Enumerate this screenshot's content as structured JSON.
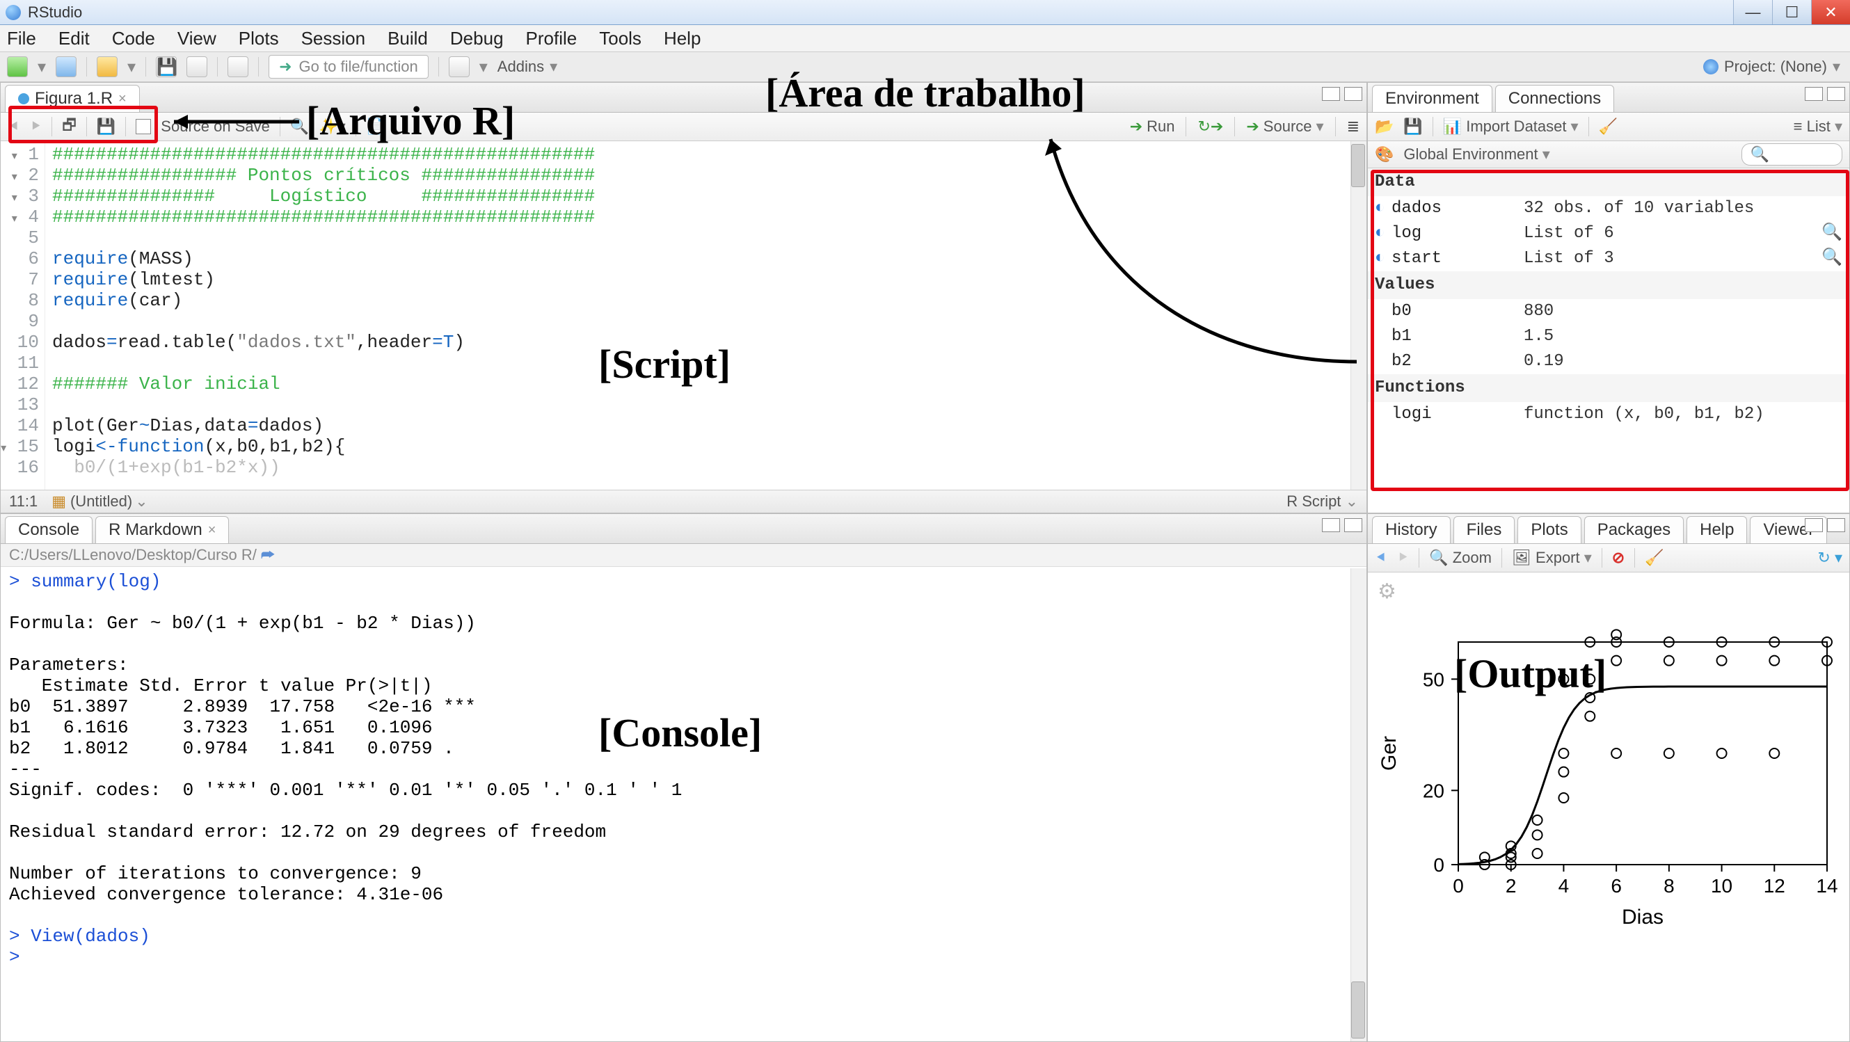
{
  "window_title": "RStudio",
  "menubar": [
    "File",
    "Edit",
    "Code",
    "View",
    "Plots",
    "Session",
    "Build",
    "Debug",
    "Profile",
    "Tools",
    "Help"
  ],
  "toolbar": {
    "goto_placeholder": "Go to file/function",
    "addins": "Addins",
    "project_label": "Project: (None)"
  },
  "source": {
    "tab_name": "Figura 1.R",
    "source_on_save": "Source on Save",
    "run": "Run",
    "source_btn": "Source",
    "status_pos": "11:1",
    "status_doc": "(Untitled)",
    "status_type": "R Script",
    "lines": [
      {
        "n": "1",
        "fold": "▾",
        "html": "<span class='c-com'>##################################################</span>"
      },
      {
        "n": "2",
        "fold": "▾",
        "html": "<span class='c-com'>################# Pontos críticos ################</span>"
      },
      {
        "n": "3",
        "fold": "▾",
        "html": "<span class='c-com'>###############     Logístico     ################</span>"
      },
      {
        "n": "4",
        "fold": "▾",
        "html": "<span class='c-com'>##################################################</span>"
      },
      {
        "n": "5",
        "html": ""
      },
      {
        "n": "6",
        "html": "<span class='c-kw'>require</span>(MASS)"
      },
      {
        "n": "7",
        "html": "<span class='c-kw'>require</span>(lmtest)"
      },
      {
        "n": "8",
        "html": "<span class='c-kw'>require</span>(car)"
      },
      {
        "n": "9",
        "html": ""
      },
      {
        "n": "10",
        "html": "dados<span class='c-op'>=</span>read.table(<span class='c-str'>\"dados.txt\"</span>,header<span class='c-op'>=</span><span class='c-kw'>T</span>)"
      },
      {
        "n": "11",
        "html": ""
      },
      {
        "n": "12",
        "html": "<span class='c-com'>####### Valor inicial</span>"
      },
      {
        "n": "13",
        "html": ""
      },
      {
        "n": "14",
        "html": "plot(Ger<span class='c-op'>~</span>Dias,data<span class='c-op'>=</span>dados)"
      },
      {
        "n": "15",
        "fold": "▾",
        "html": "logi<span class='c-op'>&lt;-</span><span class='c-kw'>function</span>(x,b0,b1,b2){"
      },
      {
        "n": "16",
        "html": "  <span style='color:#bbb'>b0/(1+exp(b1-b2*x))</span>"
      }
    ]
  },
  "console": {
    "tab1": "Console",
    "tab2": "R Markdown",
    "path": "C:/Users/LLenovo/Desktop/Curso R/",
    "text": "> summary(log)\n\nFormula: Ger ~ b0/(1 + exp(b1 - b2 * Dias))\n\nParameters:\n   Estimate Std. Error t value Pr(>|t|)\nb0  51.3897     2.8939  17.758   <2e-16 ***\nb1   6.1616     3.7323   1.651   0.1096\nb2   1.8012     0.9784   1.841   0.0759 .\n---\nSignif. codes:  0 '***' 0.001 '**' 0.01 '*' 0.05 '.' 0.1 ' ' 1\n\nResidual standard error: 12.72 on 29 degrees of freedom\n\nNumber of iterations to convergence: 9\nAchieved convergence tolerance: 4.31e-06\n\n> View(dados)\n> "
  },
  "env": {
    "tabs": [
      "Environment",
      "Connections"
    ],
    "import": "Import Dataset",
    "list": "List",
    "scope": "Global Environment",
    "search_placeholder": "",
    "sections": {
      "Data": [
        {
          "ico": "◐",
          "name": "dados",
          "val": "32 obs. of 10 variables"
        },
        {
          "ico": "◐",
          "name": "log",
          "val": "List of 6",
          "mag": true
        },
        {
          "ico": "◐",
          "name": "start",
          "val": "List of 3",
          "mag": true
        }
      ],
      "Values": [
        {
          "name": "b0",
          "val": "880"
        },
        {
          "name": "b1",
          "val": "1.5"
        },
        {
          "name": "b2",
          "val": "0.19"
        }
      ],
      "Functions": [
        {
          "name": "logi",
          "val": "function (x, b0, b1, b2)"
        }
      ]
    }
  },
  "plots": {
    "tabs": [
      "History",
      "Files",
      "Plots",
      "Packages",
      "Help",
      "Viewer"
    ],
    "zoom": "Zoom",
    "export": "Export"
  },
  "annotations": {
    "arquivo": "[Arquivo R]",
    "area": "[Área de trabalho]",
    "script": "[Script]",
    "console": "[Console]",
    "output": "[Output]"
  },
  "chart_data": {
    "type": "scatter",
    "title": "",
    "xlabel": "Dias",
    "ylabel": "Ger",
    "xlim": [
      0,
      14
    ],
    "ylim": [
      0,
      60
    ],
    "xticks": [
      0,
      2,
      4,
      6,
      8,
      10,
      12,
      14
    ],
    "yticks": [
      0,
      20,
      50
    ],
    "points": [
      {
        "x": 1,
        "y": 0
      },
      {
        "x": 1,
        "y": 0
      },
      {
        "x": 1,
        "y": 2
      },
      {
        "x": 2,
        "y": 0
      },
      {
        "x": 2,
        "y": 2
      },
      {
        "x": 2,
        "y": 3
      },
      {
        "x": 2,
        "y": 5
      },
      {
        "x": 3,
        "y": 3
      },
      {
        "x": 3,
        "y": 8
      },
      {
        "x": 3,
        "y": 12
      },
      {
        "x": 4,
        "y": 18
      },
      {
        "x": 4,
        "y": 25
      },
      {
        "x": 4,
        "y": 30
      },
      {
        "x": 4,
        "y": 50
      },
      {
        "x": 5,
        "y": 40
      },
      {
        "x": 5,
        "y": 45
      },
      {
        "x": 5,
        "y": 50
      },
      {
        "x": 5,
        "y": 60
      },
      {
        "x": 6,
        "y": 30
      },
      {
        "x": 6,
        "y": 55
      },
      {
        "x": 6,
        "y": 60
      },
      {
        "x": 6,
        "y": 62
      },
      {
        "x": 8,
        "y": 30
      },
      {
        "x": 8,
        "y": 55
      },
      {
        "x": 8,
        "y": 60
      },
      {
        "x": 10,
        "y": 30
      },
      {
        "x": 10,
        "y": 55
      },
      {
        "x": 10,
        "y": 60
      },
      {
        "x": 12,
        "y": 30
      },
      {
        "x": 12,
        "y": 55
      },
      {
        "x": 12,
        "y": 60
      },
      {
        "x": 14,
        "y": 55
      },
      {
        "x": 14,
        "y": 60
      }
    ],
    "curve": "logistic b0=48 b1=6 b2=1.8"
  }
}
